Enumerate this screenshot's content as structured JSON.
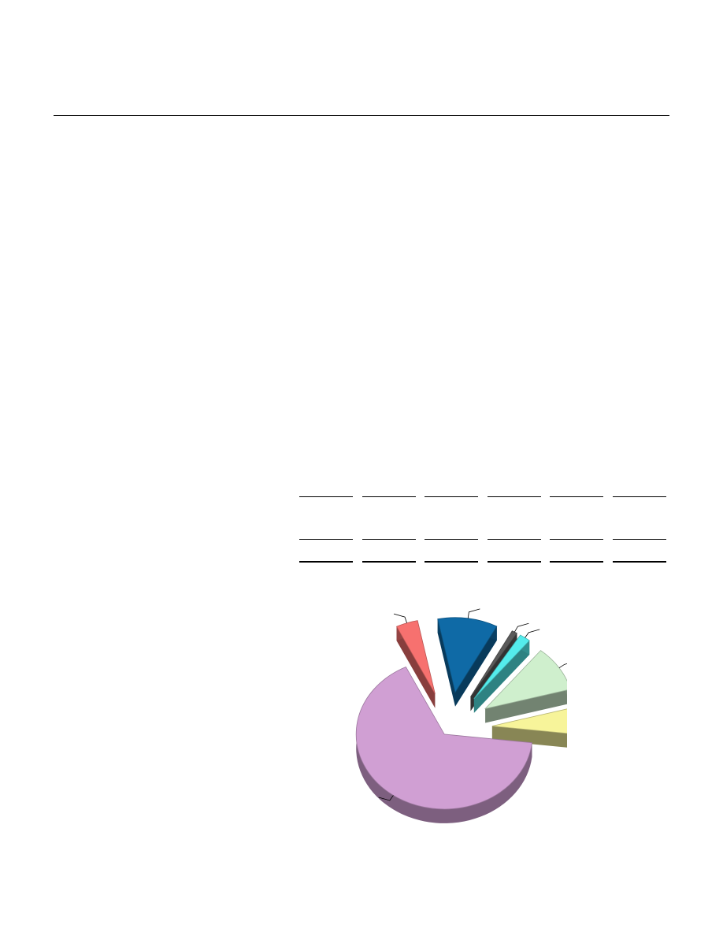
{
  "colors": {
    "rule": "#000000",
    "background": "#ffffff"
  },
  "table": {
    "column_count": 6,
    "rows": []
  },
  "chart_data": {
    "type": "pie",
    "style": "3d-exploded",
    "title": "",
    "values": [
      11,
      1,
      2,
      10,
      6,
      66,
      4
    ],
    "colors": [
      "#0f6aa6",
      "#5a5a5a",
      "#54ecec",
      "#cfefcd",
      "#f7f49a",
      "#d09fd3",
      "#f7716f"
    ],
    "labels_visible": false,
    "leader_lines": true
  }
}
